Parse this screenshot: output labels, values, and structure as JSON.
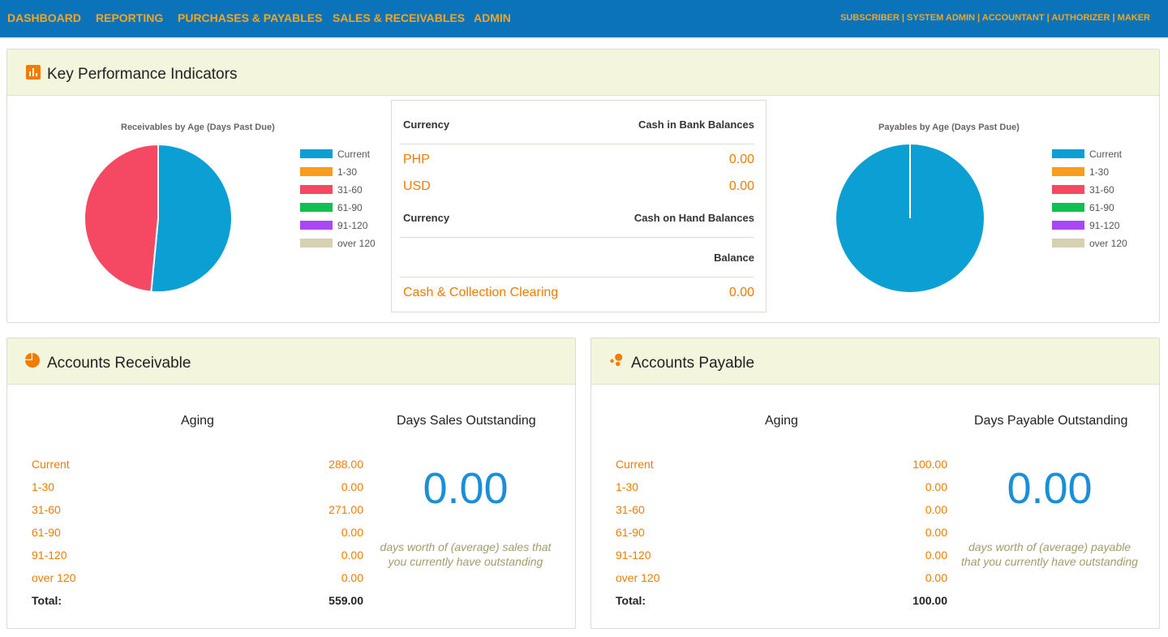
{
  "nav": {
    "items": [
      "DASHBOARD",
      "REPORTING",
      "PURCHASES & PAYABLES",
      "SALES & RECEIVABLES",
      "ADMIN"
    ],
    "roles": [
      "SUBSCRIBER",
      "SYSTEM ADMIN",
      "ACCOUNTANT",
      "AUTHORIZER",
      "MAKER"
    ],
    "role_separator": " | "
  },
  "kpi": {
    "title": "Key Performance Indicators",
    "icon": "bar-chart-icon"
  },
  "legend": {
    "labels": [
      "Current",
      "1-30",
      "31-60",
      "61-90",
      "91-120",
      "over 120"
    ],
    "colors": [
      "#0c9fd4",
      "#f99c1c",
      "#f54963",
      "#13bf4f",
      "#a748f2",
      "#d6d1b0"
    ]
  },
  "chart_data": [
    {
      "type": "pie",
      "title": "Receivables by Age (Days Past Due)",
      "categories": [
        "Current",
        "1-30",
        "31-60",
        "61-90",
        "91-120",
        "over 120"
      ],
      "values": [
        288.0,
        0.0,
        271.0,
        0.0,
        0.0,
        0.0
      ]
    },
    {
      "type": "pie",
      "title": "Payables by Age (Days Past Due)",
      "categories": [
        "Current",
        "1-30",
        "31-60",
        "61-90",
        "91-120",
        "over 120"
      ],
      "values": [
        100.0,
        0.0,
        0.0,
        0.0,
        0.0,
        0.0
      ]
    }
  ],
  "cash": {
    "bank_header_currency": "Currency",
    "bank_header_balance": "Cash in Bank Balances",
    "bank_rows": [
      {
        "currency": "PHP",
        "amount": "0.00"
      },
      {
        "currency": "USD",
        "amount": "0.00"
      }
    ],
    "hand_header_currency": "Currency",
    "hand_header_balance": "Cash on Hand Balances",
    "balance_header": "Balance",
    "clearing": {
      "label": "Cash & Collection Clearing",
      "amount": "0.00"
    }
  },
  "receivable": {
    "title": "Accounts Receivable",
    "icon": "pie-chart-icon",
    "aging_title": "Aging",
    "rows": [
      {
        "label": "Current",
        "amount": "288.00"
      },
      {
        "label": "1-30",
        "amount": "0.00"
      },
      {
        "label": "31-60",
        "amount": "271.00"
      },
      {
        "label": "61-90",
        "amount": "0.00"
      },
      {
        "label": "91-120",
        "amount": "0.00"
      },
      {
        "label": "over 120",
        "amount": "0.00"
      }
    ],
    "total_label": "Total:",
    "total_amount": "559.00",
    "metric_title": "Days Sales Outstanding",
    "metric_value": "0.00",
    "caption_line1": "days worth of (average) sales that",
    "caption_line2": "you currently have outstanding"
  },
  "payable": {
    "title": "Accounts Payable",
    "icon": "bubbles-icon",
    "aging_title": "Aging",
    "rows": [
      {
        "label": "Current",
        "amount": "100.00"
      },
      {
        "label": "1-30",
        "amount": "0.00"
      },
      {
        "label": "31-60",
        "amount": "0.00"
      },
      {
        "label": "61-90",
        "amount": "0.00"
      },
      {
        "label": "91-120",
        "amount": "0.00"
      },
      {
        "label": "over 120",
        "amount": "0.00"
      }
    ],
    "total_label": "Total:",
    "total_amount": "100.00",
    "metric_title": "Days Payable Outstanding",
    "metric_value": "0.00",
    "caption_line1": "days worth of (average) payable",
    "caption_line2": "that you currently have outstanding"
  }
}
